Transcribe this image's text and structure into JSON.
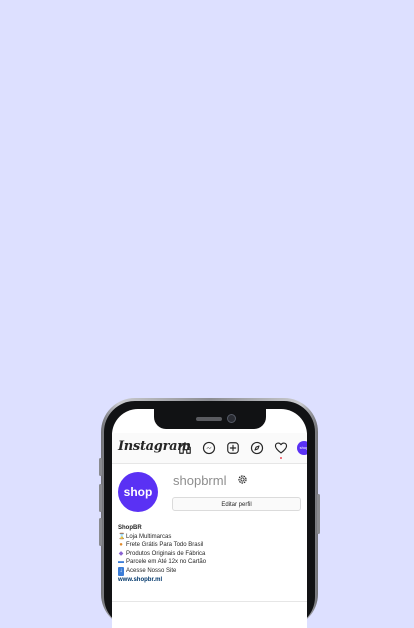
{
  "app": {
    "logo": "Instagram"
  },
  "nav": {
    "icons": [
      "home-icon",
      "messenger-icon",
      "new-post-icon",
      "explore-icon",
      "activity-icon"
    ],
    "avatar_text": "shop"
  },
  "profile": {
    "avatar_text": "shop",
    "username": "shopbrml",
    "edit_button": "Editar perfil",
    "bio": {
      "name": "ShopBR",
      "lines": [
        {
          "emoji": "⌛",
          "text": "Loja Multimarcas"
        },
        {
          "emoji": "●",
          "text": "Frete Grátis Para Todo Brasil"
        },
        {
          "emoji": "◆",
          "text": "Produtos Originais de Fábrica"
        },
        {
          "emoji": "▬",
          "text": "Parcele em Até 12x no Cartão"
        },
        {
          "emoji": "↓",
          "text": "Acesse Nosso Site"
        }
      ],
      "link": "www.shopbr.ml"
    }
  },
  "colors": {
    "background": "#dde0ff",
    "brand": "#5a31f4",
    "notification": "#ed4956",
    "link": "#00376b"
  }
}
